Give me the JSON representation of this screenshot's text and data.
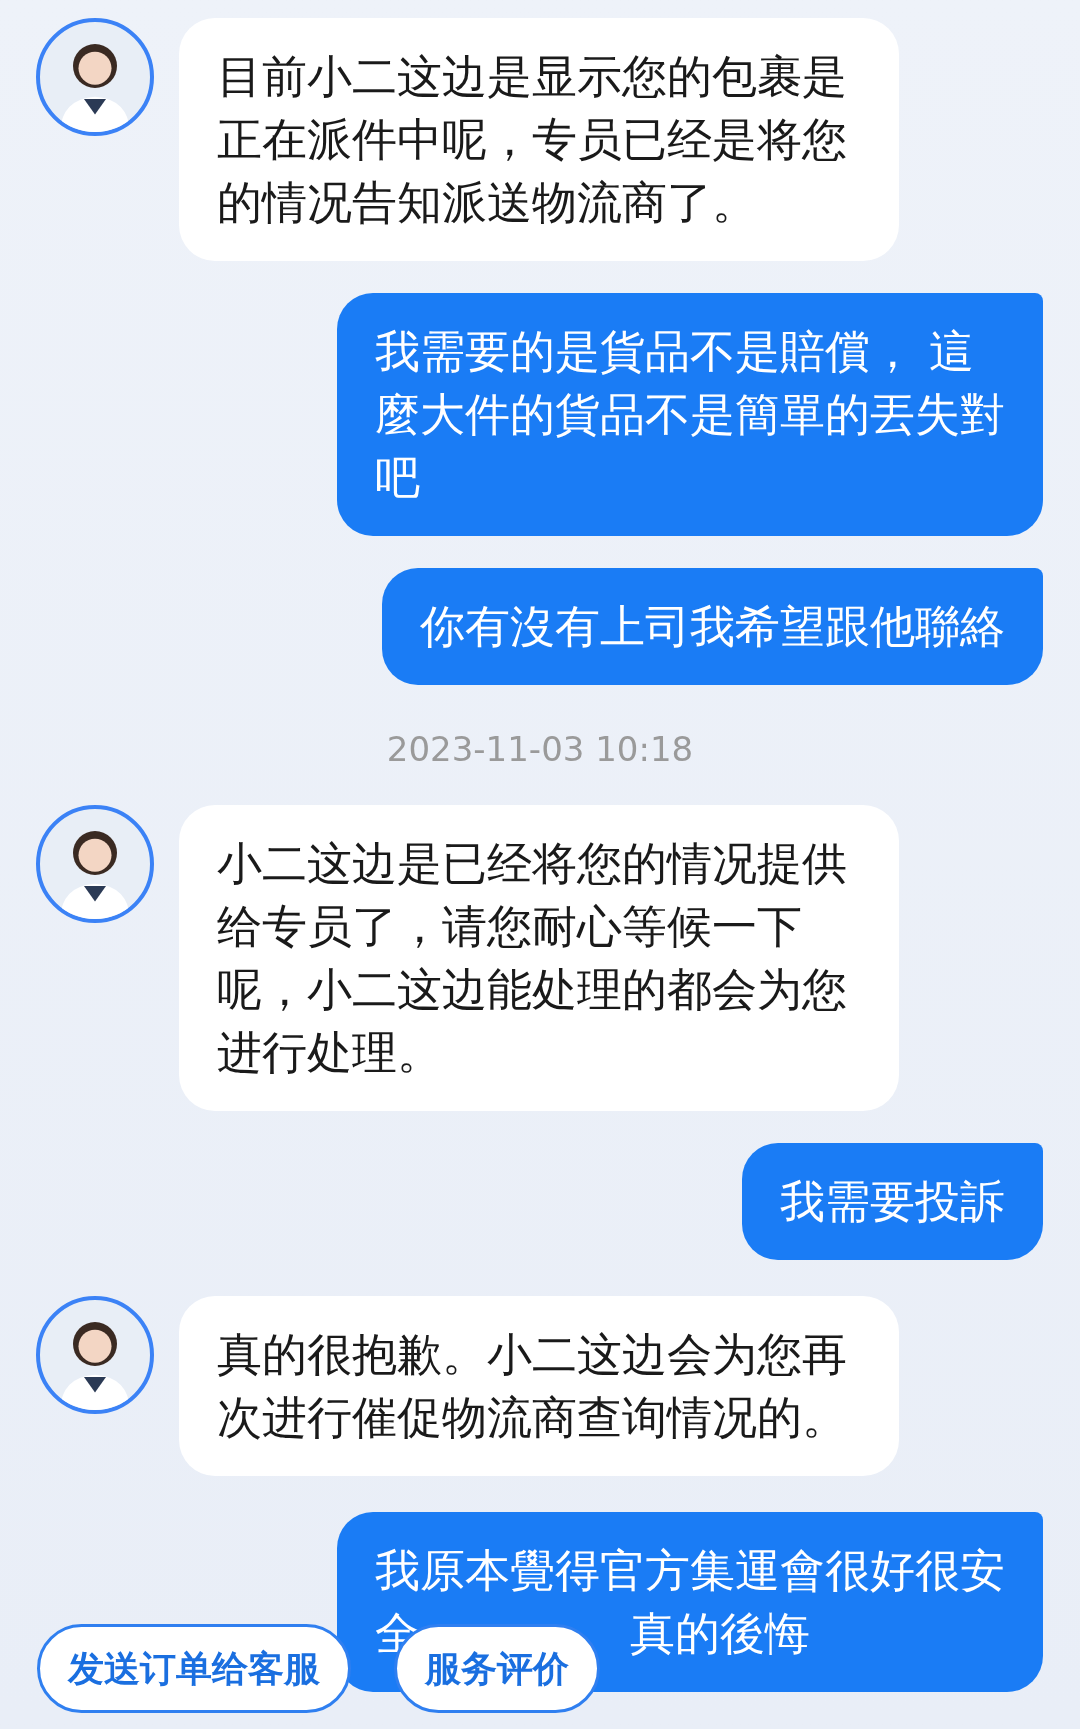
{
  "messages": [
    {
      "kind": "agent",
      "text": "目前小二这边是显示您的包裹是正在派件中呢，专员已经是将您的情况告知派送物流商了。"
    },
    {
      "kind": "user",
      "text": "我需要的是貨品不是賠償， 這麼大件的貨品不是簡單的丟失對吧"
    },
    {
      "kind": "user",
      "text": "你有沒有上司我希望跟他聯絡"
    },
    {
      "kind": "timestamp",
      "text": "2023-11-03 10:18"
    },
    {
      "kind": "agent",
      "text": "小二这边是已经将您的情况提供给专员了，请您耐心等候一下呢，小二这边能处理的都会为您进行处理。"
    },
    {
      "kind": "user",
      "text": "我需要投訴"
    },
    {
      "kind": "agent",
      "text": "真的很抱歉。小二这边会为您再次进行催促物流商查询情况的。"
    },
    {
      "kind": "user_partly_covered",
      "parts": [
        "我原本覺得官方集運會很好很安",
        "全",
        "真的後悔"
      ]
    }
  ],
  "actions": [
    "发送订单给客服",
    "服务评价"
  ]
}
